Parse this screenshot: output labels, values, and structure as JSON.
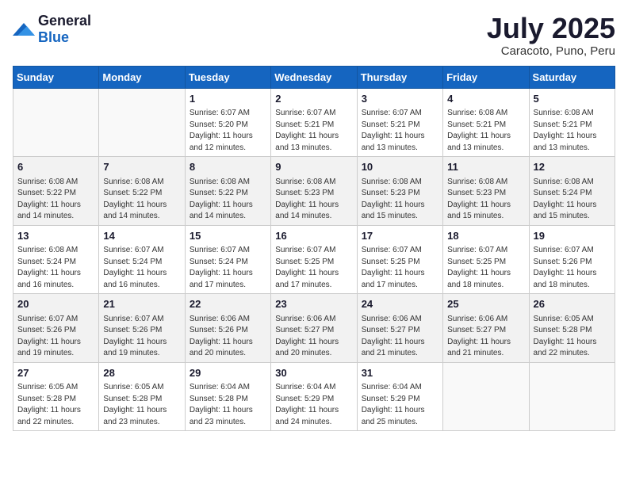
{
  "logo": {
    "general": "General",
    "blue": "Blue"
  },
  "header": {
    "month_year": "July 2025",
    "location": "Caracoto, Puno, Peru"
  },
  "weekdays": [
    "Sunday",
    "Monday",
    "Tuesday",
    "Wednesday",
    "Thursday",
    "Friday",
    "Saturday"
  ],
  "weeks": [
    [
      {
        "day": "",
        "info": ""
      },
      {
        "day": "",
        "info": ""
      },
      {
        "day": "1",
        "sunrise": "Sunrise: 6:07 AM",
        "sunset": "Sunset: 5:20 PM",
        "daylight": "Daylight: 11 hours and 12 minutes."
      },
      {
        "day": "2",
        "sunrise": "Sunrise: 6:07 AM",
        "sunset": "Sunset: 5:21 PM",
        "daylight": "Daylight: 11 hours and 13 minutes."
      },
      {
        "day": "3",
        "sunrise": "Sunrise: 6:07 AM",
        "sunset": "Sunset: 5:21 PM",
        "daylight": "Daylight: 11 hours and 13 minutes."
      },
      {
        "day": "4",
        "sunrise": "Sunrise: 6:08 AM",
        "sunset": "Sunset: 5:21 PM",
        "daylight": "Daylight: 11 hours and 13 minutes."
      },
      {
        "day": "5",
        "sunrise": "Sunrise: 6:08 AM",
        "sunset": "Sunset: 5:21 PM",
        "daylight": "Daylight: 11 hours and 13 minutes."
      }
    ],
    [
      {
        "day": "6",
        "sunrise": "Sunrise: 6:08 AM",
        "sunset": "Sunset: 5:22 PM",
        "daylight": "Daylight: 11 hours and 14 minutes."
      },
      {
        "day": "7",
        "sunrise": "Sunrise: 6:08 AM",
        "sunset": "Sunset: 5:22 PM",
        "daylight": "Daylight: 11 hours and 14 minutes."
      },
      {
        "day": "8",
        "sunrise": "Sunrise: 6:08 AM",
        "sunset": "Sunset: 5:22 PM",
        "daylight": "Daylight: 11 hours and 14 minutes."
      },
      {
        "day": "9",
        "sunrise": "Sunrise: 6:08 AM",
        "sunset": "Sunset: 5:23 PM",
        "daylight": "Daylight: 11 hours and 14 minutes."
      },
      {
        "day": "10",
        "sunrise": "Sunrise: 6:08 AM",
        "sunset": "Sunset: 5:23 PM",
        "daylight": "Daylight: 11 hours and 15 minutes."
      },
      {
        "day": "11",
        "sunrise": "Sunrise: 6:08 AM",
        "sunset": "Sunset: 5:23 PM",
        "daylight": "Daylight: 11 hours and 15 minutes."
      },
      {
        "day": "12",
        "sunrise": "Sunrise: 6:08 AM",
        "sunset": "Sunset: 5:24 PM",
        "daylight": "Daylight: 11 hours and 15 minutes."
      }
    ],
    [
      {
        "day": "13",
        "sunrise": "Sunrise: 6:08 AM",
        "sunset": "Sunset: 5:24 PM",
        "daylight": "Daylight: 11 hours and 16 minutes."
      },
      {
        "day": "14",
        "sunrise": "Sunrise: 6:07 AM",
        "sunset": "Sunset: 5:24 PM",
        "daylight": "Daylight: 11 hours and 16 minutes."
      },
      {
        "day": "15",
        "sunrise": "Sunrise: 6:07 AM",
        "sunset": "Sunset: 5:24 PM",
        "daylight": "Daylight: 11 hours and 17 minutes."
      },
      {
        "day": "16",
        "sunrise": "Sunrise: 6:07 AM",
        "sunset": "Sunset: 5:25 PM",
        "daylight": "Daylight: 11 hours and 17 minutes."
      },
      {
        "day": "17",
        "sunrise": "Sunrise: 6:07 AM",
        "sunset": "Sunset: 5:25 PM",
        "daylight": "Daylight: 11 hours and 17 minutes."
      },
      {
        "day": "18",
        "sunrise": "Sunrise: 6:07 AM",
        "sunset": "Sunset: 5:25 PM",
        "daylight": "Daylight: 11 hours and 18 minutes."
      },
      {
        "day": "19",
        "sunrise": "Sunrise: 6:07 AM",
        "sunset": "Sunset: 5:26 PM",
        "daylight": "Daylight: 11 hours and 18 minutes."
      }
    ],
    [
      {
        "day": "20",
        "sunrise": "Sunrise: 6:07 AM",
        "sunset": "Sunset: 5:26 PM",
        "daylight": "Daylight: 11 hours and 19 minutes."
      },
      {
        "day": "21",
        "sunrise": "Sunrise: 6:07 AM",
        "sunset": "Sunset: 5:26 PM",
        "daylight": "Daylight: 11 hours and 19 minutes."
      },
      {
        "day": "22",
        "sunrise": "Sunrise: 6:06 AM",
        "sunset": "Sunset: 5:26 PM",
        "daylight": "Daylight: 11 hours and 20 minutes."
      },
      {
        "day": "23",
        "sunrise": "Sunrise: 6:06 AM",
        "sunset": "Sunset: 5:27 PM",
        "daylight": "Daylight: 11 hours and 20 minutes."
      },
      {
        "day": "24",
        "sunrise": "Sunrise: 6:06 AM",
        "sunset": "Sunset: 5:27 PM",
        "daylight": "Daylight: 11 hours and 21 minutes."
      },
      {
        "day": "25",
        "sunrise": "Sunrise: 6:06 AM",
        "sunset": "Sunset: 5:27 PM",
        "daylight": "Daylight: 11 hours and 21 minutes."
      },
      {
        "day": "26",
        "sunrise": "Sunrise: 6:05 AM",
        "sunset": "Sunset: 5:28 PM",
        "daylight": "Daylight: 11 hours and 22 minutes."
      }
    ],
    [
      {
        "day": "27",
        "sunrise": "Sunrise: 6:05 AM",
        "sunset": "Sunset: 5:28 PM",
        "daylight": "Daylight: 11 hours and 22 minutes."
      },
      {
        "day": "28",
        "sunrise": "Sunrise: 6:05 AM",
        "sunset": "Sunset: 5:28 PM",
        "daylight": "Daylight: 11 hours and 23 minutes."
      },
      {
        "day": "29",
        "sunrise": "Sunrise: 6:04 AM",
        "sunset": "Sunset: 5:28 PM",
        "daylight": "Daylight: 11 hours and 23 minutes."
      },
      {
        "day": "30",
        "sunrise": "Sunrise: 6:04 AM",
        "sunset": "Sunset: 5:29 PM",
        "daylight": "Daylight: 11 hours and 24 minutes."
      },
      {
        "day": "31",
        "sunrise": "Sunrise: 6:04 AM",
        "sunset": "Sunset: 5:29 PM",
        "daylight": "Daylight: 11 hours and 25 minutes."
      },
      {
        "day": "",
        "info": ""
      },
      {
        "day": "",
        "info": ""
      }
    ]
  ]
}
